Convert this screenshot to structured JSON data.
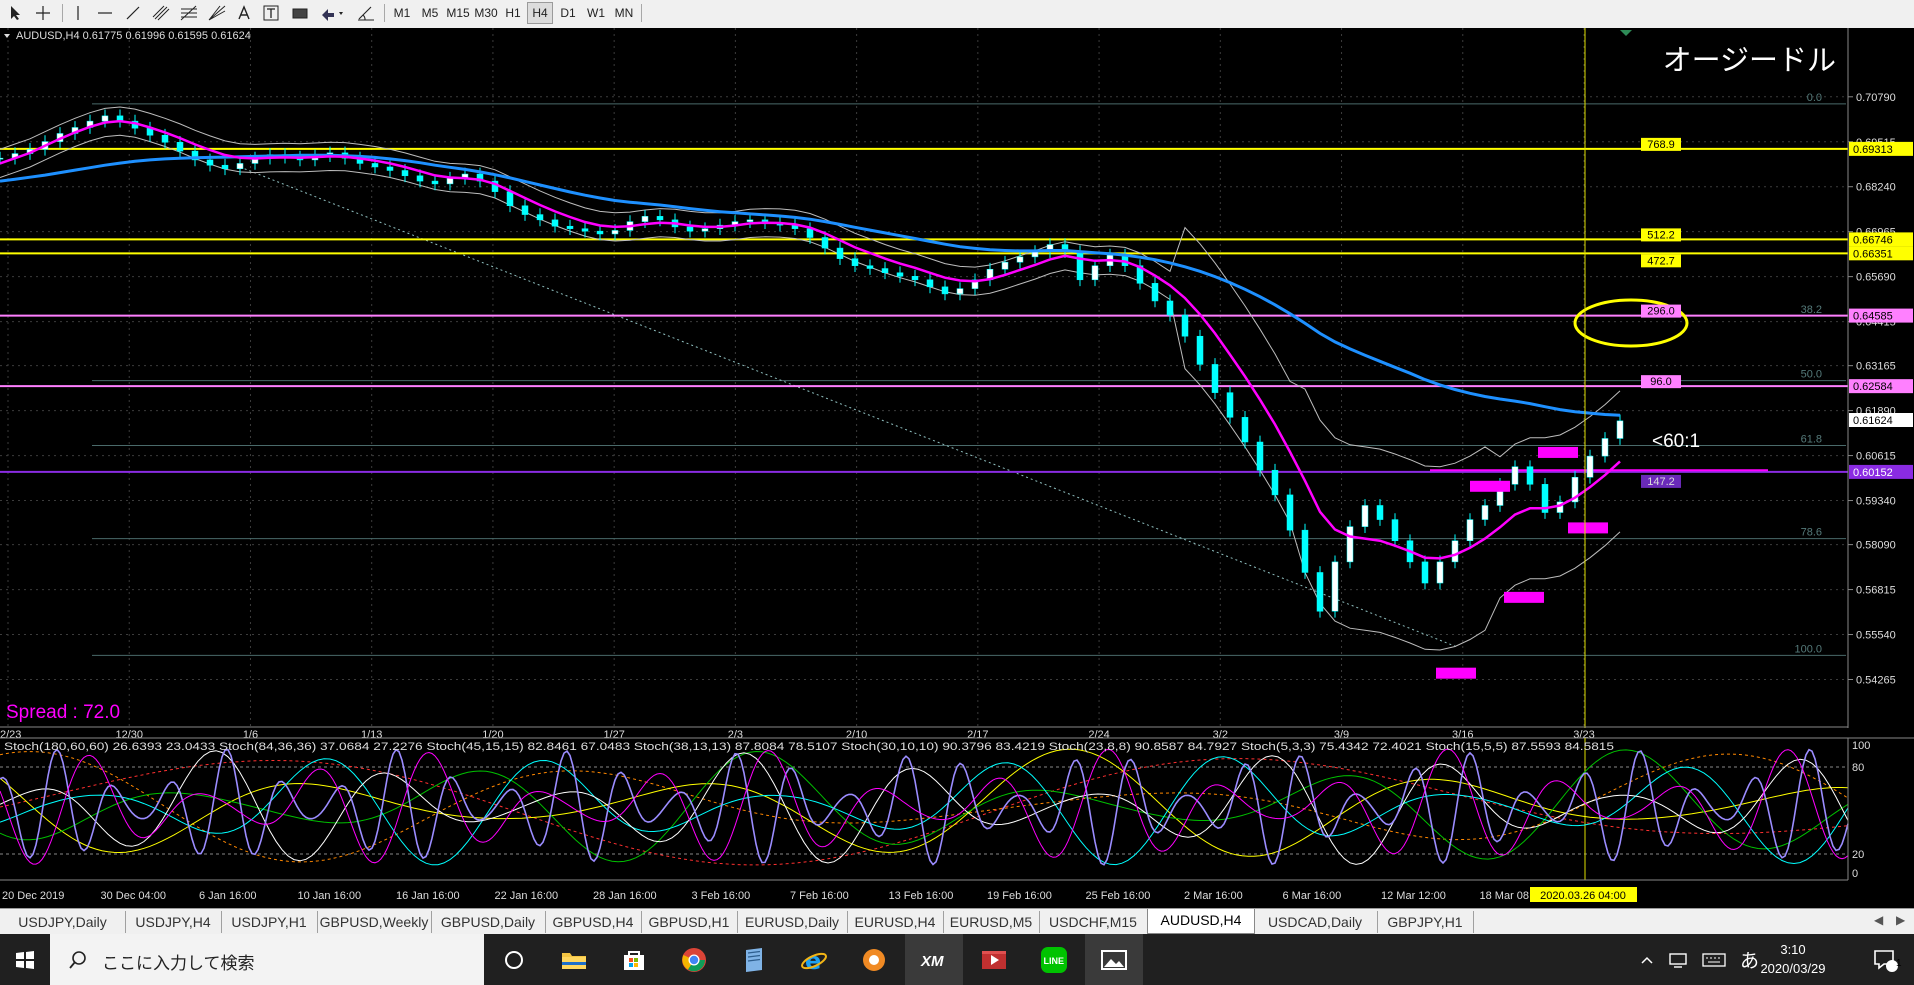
{
  "toolbar": {
    "timeframes": [
      "M1",
      "M5",
      "M15",
      "M30",
      "H1",
      "H4",
      "D1",
      "W1",
      "MN"
    ],
    "active_timeframe": "H4"
  },
  "chart_data": {
    "type": "candlestick",
    "symbol_header": "AUDUSD,H4  0.61775 0.61996 0.61595 0.61624",
    "title": "オージードル",
    "spread_label": "Spread : 72.0",
    "annotation": "<60:1",
    "ylim": [
      0.5374,
      0.7155
    ],
    "price_axis_labels": [
      "0.70790",
      "0.69515",
      "0.68240",
      "0.66965",
      "0.65690",
      "0.64415",
      "0.63165",
      "0.61890",
      "0.60615",
      "0.59340",
      "0.58090",
      "0.56815",
      "0.55540",
      "0.54265"
    ],
    "highlighted_prices": [
      {
        "label": "0.69313",
        "value": 0.69313,
        "color": "#ffff00",
        "text_color": "#000000"
      },
      {
        "label": "0.66746",
        "value": 0.66746,
        "color": "#ffff00",
        "text_color": "#000000"
      },
      {
        "label": "0.66351",
        "value": 0.66351,
        "color": "#ffff00",
        "text_color": "#000000"
      },
      {
        "label": "0.64585",
        "value": 0.64585,
        "color": "#ff80ff",
        "text_color": "#000000"
      },
      {
        "label": "0.62584",
        "value": 0.62584,
        "color": "#ff80ff",
        "text_color": "#000000"
      },
      {
        "label": "0.61624",
        "value": 0.61624,
        "color": "#ffffff",
        "text_color": "#000000"
      },
      {
        "label": "0.60152",
        "value": 0.60152,
        "color": "#8a2be2",
        "text_color": "#ffffff"
      }
    ],
    "horizontal_levels": [
      {
        "value": 0.69313,
        "color": "#ffff00",
        "tag": "768.9"
      },
      {
        "value": 0.66746,
        "color": "#ffff00",
        "tag": "512.2"
      },
      {
        "value": 0.66351,
        "color": "#ffff00",
        "tag": "472.7"
      },
      {
        "value": 0.64585,
        "color": "#ff80ff",
        "tag": "296.0"
      },
      {
        "value": 0.62584,
        "color": "#ff80ff",
        "tag": "96.0"
      },
      {
        "value": 0.60152,
        "color": "#8a2be2",
        "tag": "147.2"
      }
    ],
    "fibo_levels": [
      {
        "label": "0.0",
        "value": 0.7059
      },
      {
        "label": "38.2",
        "value": 0.6458
      },
      {
        "label": "50.0",
        "value": 0.6274
      },
      {
        "label": "61.8",
        "value": 0.609
      },
      {
        "label": "78.6",
        "value": 0.5826
      },
      {
        "label": "100.0",
        "value": 0.5495
      }
    ],
    "x_tick_labels": [
      "2/23",
      "12/30",
      "1/6",
      "1/13",
      "1/20",
      "1/27",
      "2/3",
      "2/10",
      "2/17",
      "2/24",
      "3/2",
      "3/9",
      "3/16",
      "3/23"
    ],
    "closes": [
      0.6905,
      0.6918,
      0.693,
      0.6952,
      0.6975,
      0.6992,
      0.701,
      0.7025,
      0.701,
      0.699,
      0.697,
      0.695,
      0.6925,
      0.69,
      0.6885,
      0.6875,
      0.689,
      0.6905,
      0.6915,
      0.6908,
      0.69,
      0.6912,
      0.692,
      0.6905,
      0.689,
      0.688,
      0.687,
      0.6855,
      0.684,
      0.6832,
      0.6848,
      0.686,
      0.684,
      0.681,
      0.677,
      0.6745,
      0.673,
      0.6712,
      0.6705,
      0.6698,
      0.669,
      0.67,
      0.6725,
      0.674,
      0.673,
      0.671,
      0.6698,
      0.6705,
      0.6715,
      0.6725,
      0.673,
      0.6722,
      0.6715,
      0.6705,
      0.668,
      0.665,
      0.662,
      0.66,
      0.6592,
      0.658,
      0.657,
      0.656,
      0.654,
      0.652,
      0.6535,
      0.656,
      0.659,
      0.661,
      0.6625,
      0.664,
      0.666,
      0.664,
      0.656,
      0.66,
      0.663,
      0.66,
      0.655,
      0.65,
      0.646,
      0.64,
      0.632,
      0.624,
      0.617,
      0.61,
      0.602,
      0.595,
      0.585,
      0.573,
      0.562,
      0.576,
      0.586,
      0.592,
      0.588,
      0.582,
      0.576,
      0.57,
      0.576,
      0.582,
      0.588,
      0.592,
      0.598,
      0.603,
      0.598,
      0.59,
      0.593,
      0.6,
      0.606,
      0.611,
      0.616
    ],
    "ma_fast": [
      0.689,
      0.6905,
      0.692,
      0.694,
      0.696,
      0.6978,
      0.6994,
      0.7006,
      0.701,
      0.7004,
      0.6992,
      0.6978,
      0.6962,
      0.6944,
      0.6928,
      0.6914,
      0.6906,
      0.6904,
      0.6906,
      0.6907,
      0.6906,
      0.6908,
      0.691,
      0.6909,
      0.6904,
      0.6898,
      0.689,
      0.688,
      0.6868,
      0.6856,
      0.685,
      0.6848,
      0.6844,
      0.6832,
      0.6812,
      0.6792,
      0.6772,
      0.6754,
      0.6738,
      0.6724,
      0.6714,
      0.671,
      0.6712,
      0.6718,
      0.6722,
      0.672,
      0.6714,
      0.671,
      0.671,
      0.6714,
      0.672,
      0.6722,
      0.6721,
      0.6717,
      0.6708,
      0.6692,
      0.6672,
      0.6652,
      0.6636,
      0.662,
      0.6606,
      0.6594,
      0.658,
      0.6566,
      0.6558,
      0.6556,
      0.6562,
      0.6574,
      0.6588,
      0.6602,
      0.6618,
      0.6628,
      0.662,
      0.6614,
      0.6616,
      0.6612,
      0.6596,
      0.6572,
      0.6544,
      0.6508,
      0.6462,
      0.6408,
      0.6348,
      0.6286,
      0.622,
      0.615,
      0.6072,
      0.599,
      0.5902,
      0.5852,
      0.5832,
      0.5826,
      0.582,
      0.5806,
      0.579,
      0.5772,
      0.577,
      0.578,
      0.58,
      0.5826,
      0.5858,
      0.5894,
      0.5912,
      0.5912,
      0.592,
      0.5942,
      0.5972,
      0.6006,
      0.6045
    ],
    "ma_slow": [
      0.684,
      0.6845,
      0.6851,
      0.6857,
      0.6864,
      0.6871,
      0.6878,
      0.6885,
      0.6891,
      0.6896,
      0.69,
      0.6903,
      0.6905,
      0.6906,
      0.6907,
      0.6908,
      0.6909,
      0.691,
      0.6911,
      0.6912,
      0.6913,
      0.6913,
      0.6913,
      0.6912,
      0.691,
      0.6907,
      0.6903,
      0.6898,
      0.6892,
      0.6885,
      0.6879,
      0.6873,
      0.6866,
      0.6858,
      0.6849,
      0.6839,
      0.6829,
      0.6819,
      0.6809,
      0.68,
      0.6792,
      0.6785,
      0.678,
      0.6776,
      0.6772,
      0.6767,
      0.6762,
      0.6757,
      0.6753,
      0.675,
      0.6747,
      0.6744,
      0.6741,
      0.6737,
      0.6732,
      0.6725,
      0.6717,
      0.6709,
      0.6701,
      0.6693,
      0.6685,
      0.6677,
      0.6669,
      0.6661,
      0.6654,
      0.6649,
      0.6645,
      0.6643,
      0.6642,
      0.6642,
      0.6643,
      0.6643,
      0.664,
      0.6637,
      0.6634,
      0.663,
      0.6624,
      0.6617,
      0.6608,
      0.6597,
      0.6584,
      0.6569,
      0.6552,
      0.6533,
      0.6512,
      0.6489,
      0.6464,
      0.6437,
      0.6408,
      0.6384,
      0.6364,
      0.6346,
      0.6329,
      0.6312,
      0.6295,
      0.6277,
      0.6262,
      0.6249,
      0.6238,
      0.6229,
      0.6222,
      0.6216,
      0.6209,
      0.62,
      0.6192,
      0.6186,
      0.6182,
      0.6178,
      0.6176
    ],
    "stoch_panel": {
      "header": "Stoch(180,60,60) 26.6393 23.0433  Stoch(84,36,36) 37.0684 27.2276  Stoch(45,15,15) 82.8461 67.0483  Stoch(38,13,13) 87.8084 78.5107  Stoch(30,10,10) 90.3796 83.4219  Stoch(23,8,8) 90.8587 84.7927  Stoch(5,3,3) 75.4342 72.4021  Stoch(15,5,5) 87.5593 84.5815",
      "levels": [
        "100",
        "80",
        "20",
        "0"
      ]
    },
    "time_axis_labels": [
      "20 Dec 2019",
      "30 Dec 04:00",
      "6 Jan 16:00",
      "10 Jan 16:00",
      "16 Jan 16:00",
      "22 Jan 16:00",
      "28 Jan 16:00",
      "3 Feb 16:00",
      "7 Feb 16:00",
      "13 Feb 16:00",
      "19 Feb 16:00",
      "25 Feb 16:00",
      "2 Mar 16:00",
      "6 Mar 16:00",
      "12 Mar 12:00",
      "18 Mar 08:00"
    ],
    "cursor_time_label": "2020.03.26 04:00"
  },
  "tabs": {
    "items": [
      "USDJPY,Daily",
      "USDJPY,H4",
      "USDJPY,H1",
      "GBPUSD,Weekly",
      "GBPUSD,Daily",
      "GBPUSD,H4",
      "GBPUSD,H1",
      "EURUSD,Daily",
      "EURUSD,H4",
      "EURUSD,M5",
      "USDCHF,M15",
      "AUDUSD,H4",
      "USDCAD,Daily",
      "GBPJPY,H1"
    ],
    "active": "AUDUSD,H4"
  },
  "taskbar": {
    "search_placeholder": "ここに入力して検索",
    "ime": "あ",
    "time": "3:10",
    "date": "2020/03/29",
    "notifications": "1"
  }
}
